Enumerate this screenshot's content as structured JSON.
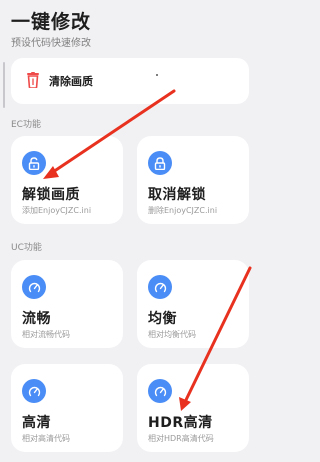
{
  "header": {
    "title": "一键修改",
    "subtitle": "预设代码快速修改"
  },
  "clear_card": {
    "label": "清除画质",
    "icon": "trash-icon"
  },
  "sections": {
    "ec": "EC功能",
    "uc": "UC功能"
  },
  "tiles": [
    {
      "title": "解锁画质",
      "desc": "添加EnjoyCJZC.ini",
      "icon": "unlock-icon"
    },
    {
      "title": "取消解锁",
      "desc": "删除EnjoyCJZC.ini",
      "icon": "lock-icon"
    },
    {
      "title": "流畅",
      "desc": "相对流畅代码",
      "icon": "speedometer-icon"
    },
    {
      "title": "均衡",
      "desc": "相对均衡代码",
      "icon": "speedometer-icon"
    },
    {
      "title": "高清",
      "desc": "相对高清代码",
      "icon": "speedometer-icon"
    },
    {
      "title": "HDR高清",
      "desc": "相对HDR高清代码",
      "icon": "speedometer-icon"
    }
  ],
  "colors": {
    "accent": "#4a8df6",
    "annotation_arrow": "#e8311f",
    "trash": "#ef4b4b"
  }
}
